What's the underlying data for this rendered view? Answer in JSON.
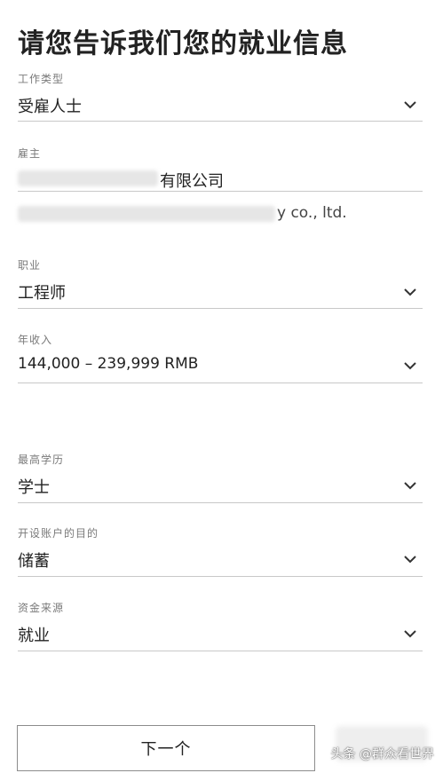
{
  "page": {
    "title": "请您告诉我们您的就业信息"
  },
  "fields": {
    "work_type": {
      "label": "工作类型",
      "value": "受雇人士"
    },
    "employer": {
      "label": "雇主",
      "value_cn_suffix": "有限公司",
      "value_en_suffix": "y co., ltd."
    },
    "occupation": {
      "label": "职业",
      "value": "工程师"
    },
    "annual_income": {
      "label": "年收入",
      "value": "144,000 – 239,999 RMB"
    },
    "education": {
      "label": "最高学历",
      "value": "学士"
    },
    "account_purpose": {
      "label": "开设账户的目的",
      "value": "储蓄"
    },
    "fund_source": {
      "label": "资金来源",
      "value": "就业"
    }
  },
  "actions": {
    "next_label": "下一个"
  },
  "watermark": {
    "text": "头条 @群众看世界"
  },
  "icons": {
    "dropdown": "chevron-down-icon"
  }
}
